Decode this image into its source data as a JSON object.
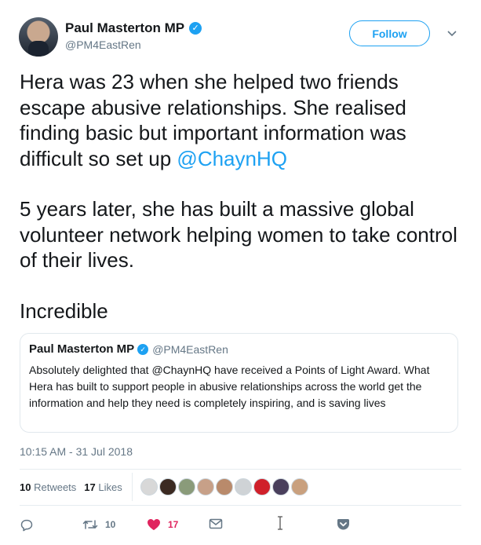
{
  "author": {
    "name": "Paul Masterton MP",
    "handle": "@PM4EastRen",
    "verified_glyph": "✓"
  },
  "follow_label": "Follow",
  "caret_glyph": "⌄",
  "tweet": {
    "line1": "Hera was 23 when she helped two friends escape abusive relationships. She realised finding basic but important information was difficult so set up ",
    "mention": "@ChaynHQ",
    "para2": "5 years later, she has built a massive global volunteer network helping women to take control of their lives.",
    "para3": "Incredible"
  },
  "quoted": {
    "name": "Paul Masterton MP",
    "handle": "@PM4EastRen",
    "text": "Absolutely delighted that @ChaynHQ have received a Points of Light Award. What Hera has built to support people in abusive relationships across the world get the information and help they need is completely inspiring, and is saving lives"
  },
  "timestamp": "10:15 AM - 31 Jul 2018",
  "stats": {
    "retweets_count": "10",
    "retweets_label": "Retweets",
    "likes_count": "17",
    "likes_label": "Likes"
  },
  "liker_faces": [
    "#d8d8d8",
    "#3b2a22",
    "#8a9b7a",
    "#c7a088",
    "#b98a6b",
    "#cfd3d6",
    "#d0202a",
    "#4a3f5c",
    "#c9a07e"
  ],
  "actions": {
    "reply_count": "",
    "retweet_count": "10",
    "like_count": "17"
  },
  "colors": {
    "accent": "#1da1f2",
    "like": "#e0245e",
    "muted": "#657786"
  }
}
